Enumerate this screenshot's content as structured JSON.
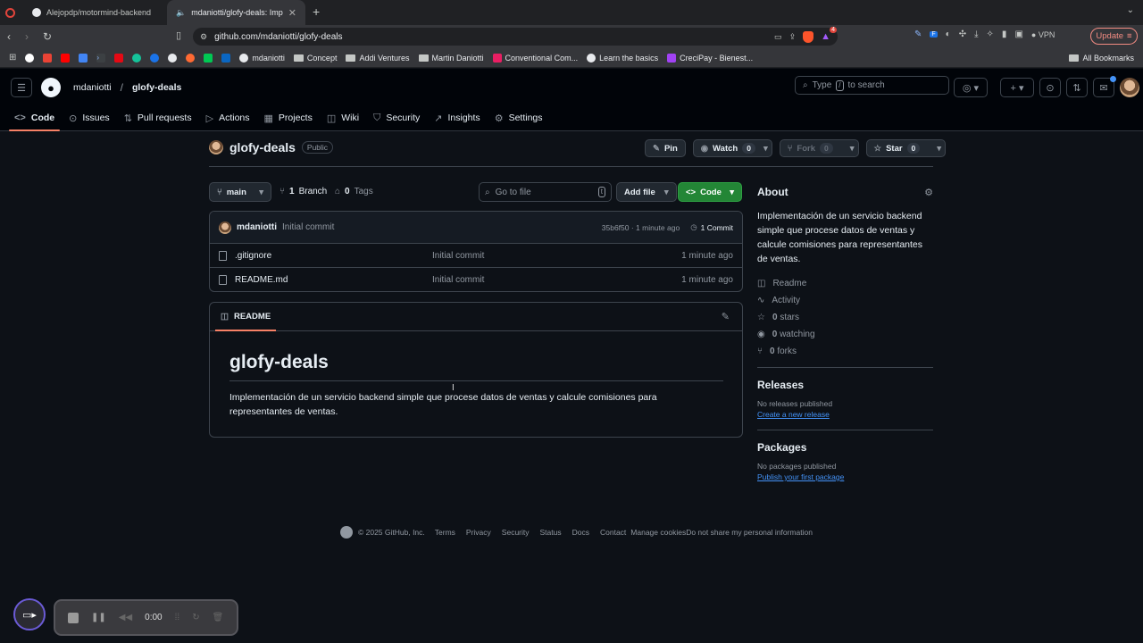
{
  "browser": {
    "tabs": [
      {
        "title": "Alejopdp/motormind-backend"
      },
      {
        "title": "mdaniotti/glofy-deals: Imp"
      }
    ],
    "url": "github.com/mdaniotti/glofy-deals",
    "vpn_label": "VPN",
    "update_label": "Update",
    "shields_badge": "4",
    "bookmarks": [
      "mdaniotti",
      "Concept",
      "Addi Ventures",
      "Martin Daniotti",
      "Conventional Com...",
      "Learn the basics",
      "CreciPay - Bienest..."
    ],
    "all_bookmarks": "All Bookmarks"
  },
  "gh": {
    "owner": "mdaniotti",
    "repo": "glofy-deals",
    "search": {
      "prefix": "Type",
      "key": "/",
      "suffix": "to search"
    },
    "tabs": [
      "Code",
      "Issues",
      "Pull requests",
      "Actions",
      "Projects",
      "Wiki",
      "Security",
      "Insights",
      "Settings"
    ]
  },
  "repo": {
    "name": "glofy-deals",
    "visibility": "Public",
    "pin": "Pin",
    "watch": "Watch",
    "watch_count": "0",
    "fork": "Fork",
    "fork_count": "0",
    "star": "Star",
    "star_count": "0",
    "branch": "main",
    "branches_count": "1",
    "branches_label": "Branch",
    "tags_count": "0",
    "tags_label": "Tags",
    "goto_placeholder": "Go to file",
    "goto_key": "t",
    "add_file": "Add file",
    "code": "Code"
  },
  "commit": {
    "author": "mdaniotti",
    "message": "Initial commit",
    "hash_time": "35b6f50 · 1 minute ago",
    "commits": "1 Commit"
  },
  "files": [
    {
      "name": ".gitignore",
      "message": "Initial commit",
      "time": "1 minute ago"
    },
    {
      "name": "README.md",
      "message": "Initial commit",
      "time": "1 minute ago"
    }
  ],
  "readme": {
    "tab": "README",
    "title": "glofy-deals",
    "body": "Implementación de un servicio backend simple que procese datos de ventas y calcule comisiones para representantes de ventas."
  },
  "about": {
    "title": "About",
    "description": "Implementación de un servicio backend simple que procese datos de ventas y calcule comisiones para representantes de ventas.",
    "readme": "Readme",
    "activity": "Activity",
    "stars_n": "0",
    "stars": "stars",
    "watching_n": "0",
    "watching": "watching",
    "forks_n": "0",
    "forks": "forks",
    "releases_title": "Releases",
    "releases_none": "No releases published",
    "releases_link": "Create a new release",
    "packages_title": "Packages",
    "packages_none": "No packages published",
    "packages_link": "Publish your first package"
  },
  "footer": {
    "copyright": "© 2025 GitHub, Inc.",
    "links": [
      "Terms",
      "Privacy",
      "Security",
      "Status",
      "Docs",
      "Contact",
      "Manage cookies",
      "Do not share my personal information"
    ]
  },
  "recorder": {
    "time": "0:00"
  }
}
